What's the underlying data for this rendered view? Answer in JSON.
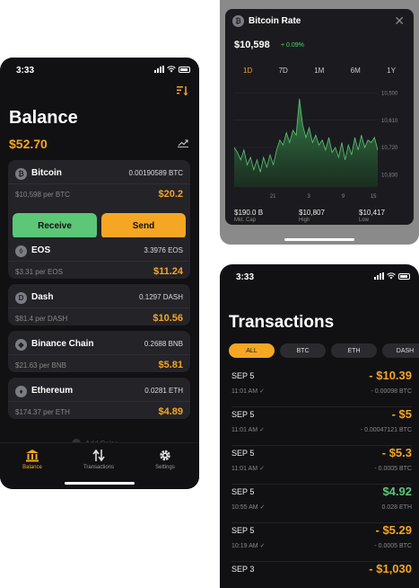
{
  "colors": {
    "accent": "#f5a623",
    "green": "#5cc776",
    "panel": "#232328",
    "background": "#111114"
  },
  "balance": {
    "status_time": "3:33",
    "title": "Balance",
    "amount": "$52.70",
    "coins": [
      {
        "name": "Bitcoin",
        "holding": "0.00190589 BTC",
        "rate": "$10,598 per BTC",
        "value": "$20.2",
        "icon": "bitcoin-icon",
        "glyph": "₿"
      },
      {
        "name": "EOS",
        "holding": "3.3976 EOS",
        "rate": "$3.31 per EOS",
        "value": "$11.24",
        "icon": "eos-icon",
        "glyph": "◊"
      },
      {
        "name": "Dash",
        "holding": "0.1297 DASH",
        "rate": "$81.4 per DASH",
        "value": "$10.56",
        "icon": "dash-icon",
        "glyph": "D"
      },
      {
        "name": "Binance Chain",
        "holding": "0.2688 BNB",
        "rate": "$21.63 per BNB",
        "value": "$5.81",
        "icon": "binance-icon",
        "glyph": "◆"
      },
      {
        "name": "Ethereum",
        "holding": "0.0281 ETH",
        "rate": "$174.37 per ETH",
        "value": "$4.89",
        "icon": "ethereum-icon",
        "glyph": "♦"
      }
    ],
    "receive_label": "Receive",
    "send_label": "Send",
    "add_coins": "Add Coins",
    "tabs": [
      {
        "label": "Balance",
        "icon": "bank-icon",
        "active": true
      },
      {
        "label": "Transactions",
        "icon": "transfer-arrows-icon",
        "active": false
      },
      {
        "label": "Settings",
        "icon": "gear-icon",
        "active": false
      }
    ]
  },
  "rate": {
    "title": "Bitcoin Rate",
    "price": "$10,598",
    "change": "+ 0.09%",
    "periods": [
      "1D",
      "7D",
      "1M",
      "6M",
      "1Y"
    ],
    "active_period": "1D",
    "y_ticks": [
      "10,830",
      "10,720",
      "10,610",
      "10,500"
    ],
    "x_ticks": [
      "21",
      "3",
      "9",
      "15"
    ],
    "stats": [
      {
        "value": "$190.0 B",
        "label": "Mkt. Cap"
      },
      {
        "value": "$10,807",
        "label": "High"
      },
      {
        "value": "$10,417",
        "label": "Low"
      }
    ]
  },
  "chart_data": {
    "type": "area",
    "title": "",
    "ylim": [
      10450,
      10850
    ],
    "y_ticks": [
      10500,
      10610,
      10720,
      10830
    ],
    "x_ticks": [
      "21",
      "3",
      "9",
      "15"
    ],
    "series": [
      {
        "values": [
          10610,
          10590,
          10560,
          10600,
          10540,
          10570,
          10520,
          10560,
          10510,
          10570,
          10530,
          10580,
          10540,
          10600,
          10640,
          10620,
          10670,
          10630,
          10680,
          10660,
          10807,
          10700,
          10650,
          10690,
          10630,
          10660,
          10620,
          10640,
          10600,
          10650,
          10590,
          10610,
          10570,
          10630,
          10560,
          10620,
          10580,
          10650,
          10600,
          10660,
          10610,
          10640,
          10630,
          10650,
          10600
        ]
      }
    ]
  },
  "transactions": {
    "status_time": "3:33",
    "title": "Transactions",
    "filters": [
      "ALL",
      "BTC",
      "ETH",
      "DASH"
    ],
    "active_filter": "ALL",
    "rows": [
      {
        "date": "SEP 5",
        "time": "11:01 AM",
        "amount": "- $10.39",
        "sub": "- 0.00098 BTC",
        "positive": false
      },
      {
        "date": "SEP 5",
        "time": "11:01 AM",
        "amount": "- $5",
        "sub": "- 0.00047121 BTC",
        "positive": false
      },
      {
        "date": "SEP 5",
        "time": "11:01 AM",
        "amount": "- $5.3",
        "sub": "- 0.0005 BTC",
        "positive": false
      },
      {
        "date": "SEP 5",
        "time": "10:55 AM",
        "amount": "$4.92",
        "sub": "0.028 ETH",
        "positive": true
      },
      {
        "date": "SEP 5",
        "time": "10:19 AM",
        "amount": "- $5.29",
        "sub": "- 0.0005 BTC",
        "positive": false
      },
      {
        "date": "SEP 3",
        "time": "",
        "amount": "- $1,030",
        "sub": "",
        "positive": false
      }
    ]
  }
}
